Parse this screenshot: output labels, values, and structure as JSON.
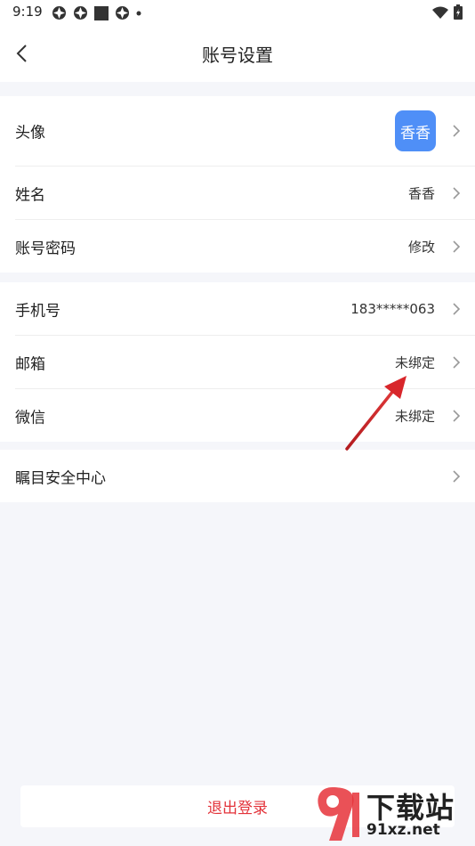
{
  "status_bar": {
    "time": "9:19"
  },
  "header": {
    "title": "账号设置"
  },
  "groups": [
    {
      "rows": [
        {
          "label": "头像",
          "avatar_text": "香香"
        },
        {
          "label": "姓名",
          "value": "香香"
        },
        {
          "label": "账号密码",
          "value": "修改"
        }
      ]
    },
    {
      "rows": [
        {
          "label": "手机号",
          "value": "183*****063"
        },
        {
          "label": "邮箱",
          "value": "未绑定"
        },
        {
          "label": "微信",
          "value": "未绑定"
        }
      ]
    },
    {
      "rows": [
        {
          "label": "瞩目安全中心"
        }
      ]
    }
  ],
  "logout": {
    "label": "退出登录"
  },
  "watermark": {
    "line1": "下载站",
    "line2": "91xz.net"
  },
  "colors": {
    "accent": "#4f8ff7",
    "logout": "#e3333a",
    "annotation_arrow": "#d8262b"
  }
}
